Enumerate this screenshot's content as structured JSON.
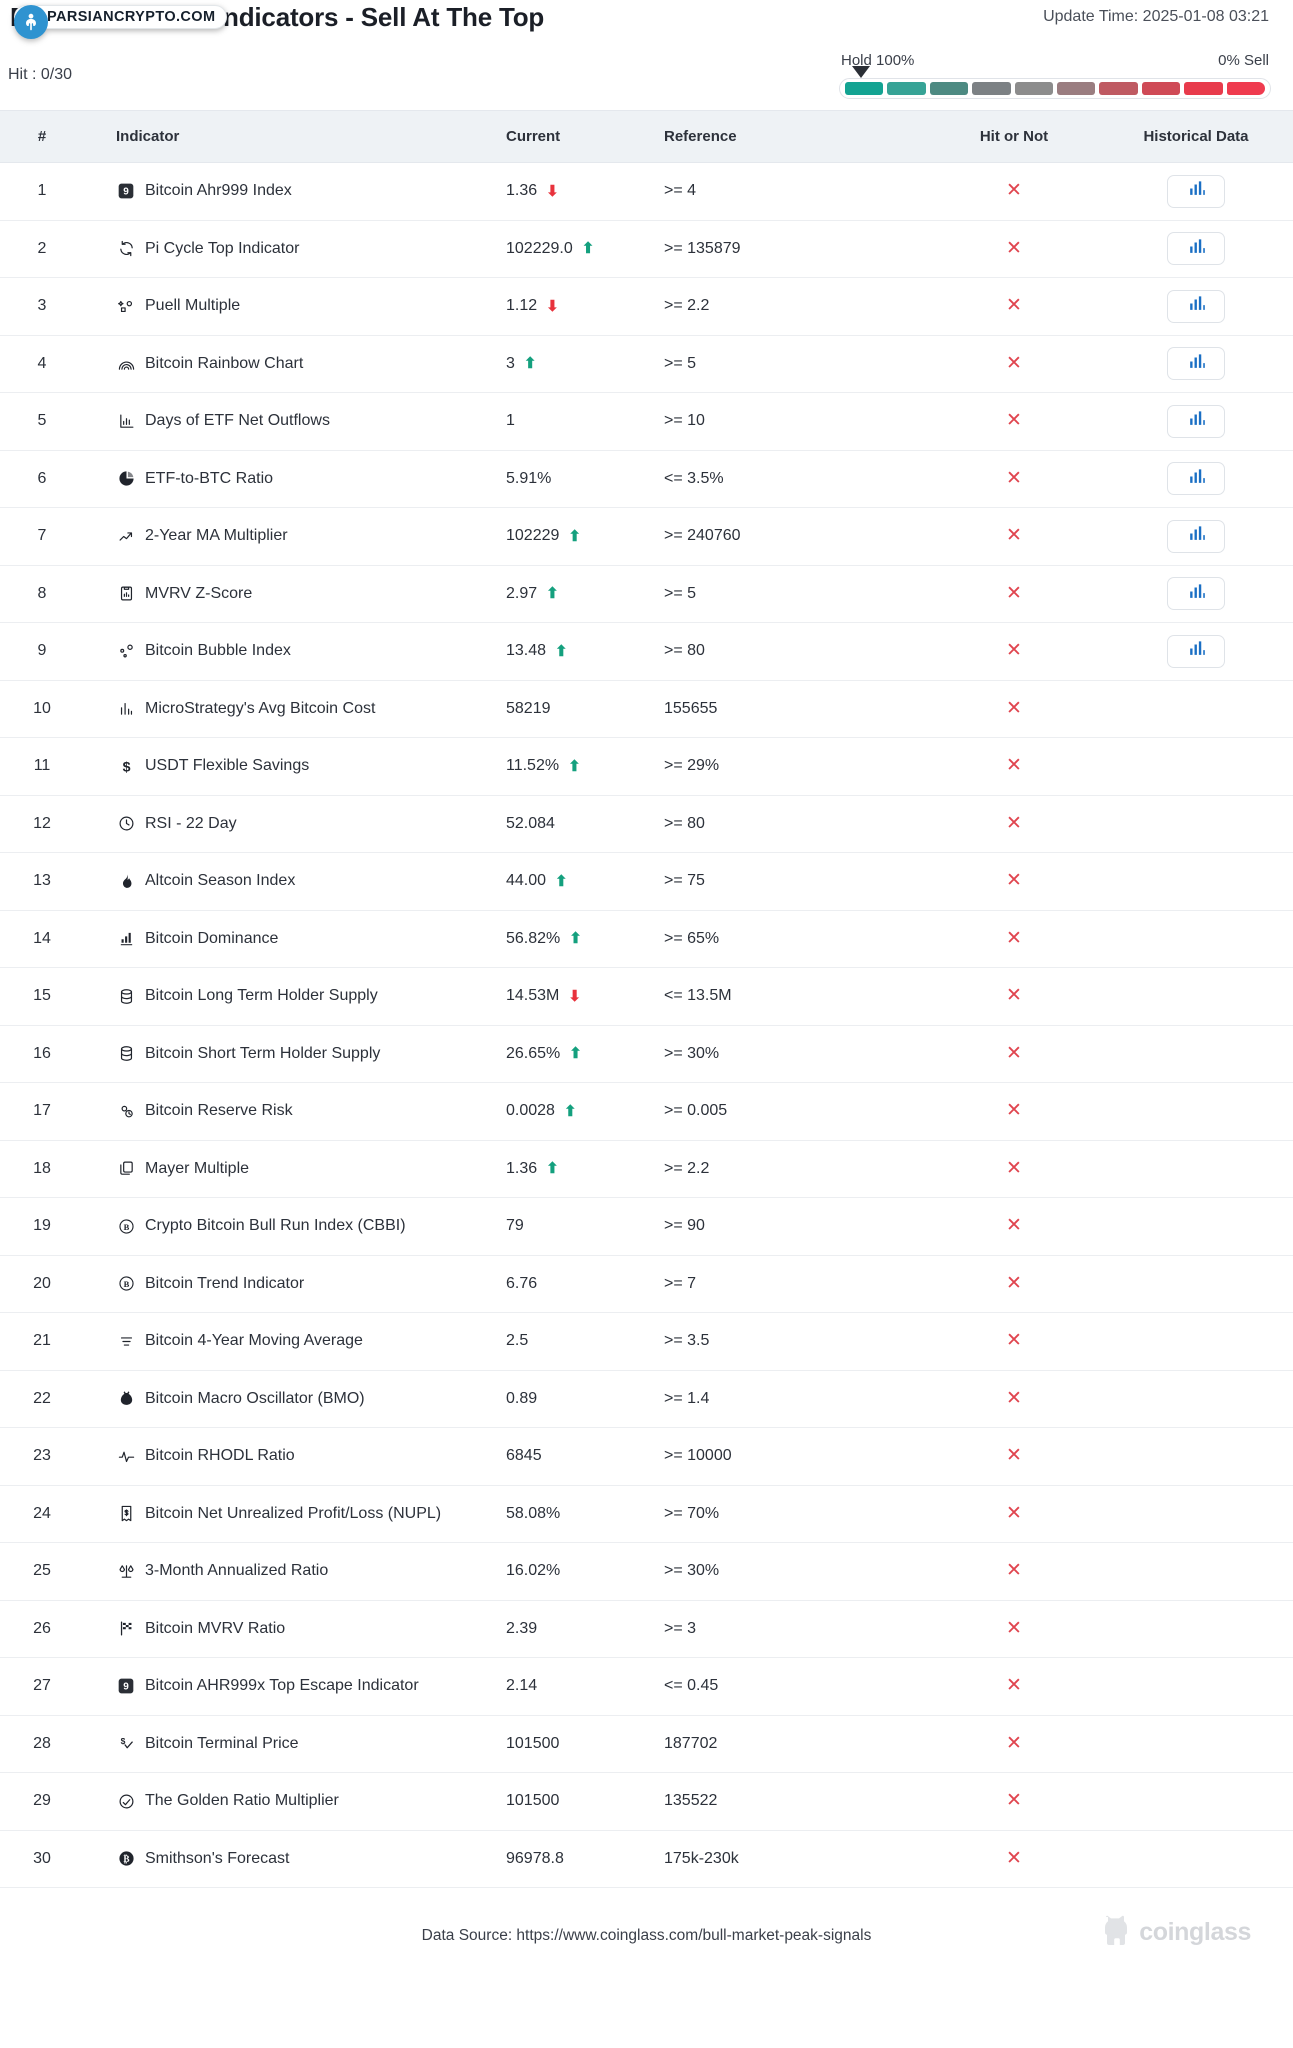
{
  "header": {
    "title": "Bitcoin Bull Run Indicators - Sell At The Top",
    "update_time": "Update Time: 2025-01-08 03:21",
    "watermark": "PARSIANCRYPTO.COM",
    "watermark_icon": "parsiancrypto-logo-icon"
  },
  "summary": {
    "hit_label": "Hit : 0/30",
    "gauge_left_label": "Hold 100%",
    "gauge_right_label": "0% Sell",
    "gauge_pointer_percent": 0,
    "gauge_segments": [
      "#13a392",
      "#36a396",
      "#4d8a82",
      "#7c8184",
      "#8c8c8c",
      "#9a7d80",
      "#bf5a62",
      "#cf4a56",
      "#e83b4c",
      "#ef3b4f"
    ]
  },
  "table": {
    "columns": [
      "#",
      "Indicator",
      "Current",
      "Reference",
      "Hit or Not",
      "Historical Data"
    ],
    "hit_icon": "x-mark-icon",
    "history_icon": "bar-chart-icon",
    "rows": [
      {
        "num": "1",
        "icon": "ahr999-badge-icon",
        "name": "Bitcoin Ahr999 Index",
        "current": "1.36",
        "trend": "down",
        "reference": ">= 4",
        "hit": false,
        "history": true
      },
      {
        "num": "2",
        "icon": "refresh-cycle-icon",
        "name": "Pi Cycle Top Indicator",
        "current": "102229.0",
        "trend": "up",
        "reference": ">= 135879",
        "hit": false,
        "history": true
      },
      {
        "num": "3",
        "icon": "sparkle-node-icon",
        "name": "Puell Multiple",
        "current": "1.12",
        "trend": "down",
        "reference": ">= 2.2",
        "hit": false,
        "history": true
      },
      {
        "num": "4",
        "icon": "rainbow-icon",
        "name": "Bitcoin Rainbow Chart",
        "current": "3",
        "trend": "up",
        "reference": ">= 5",
        "hit": false,
        "history": true
      },
      {
        "num": "5",
        "icon": "bar-chart-axis-icon",
        "name": "Days of ETF Net Outflows",
        "current": "1",
        "trend": "none",
        "reference": ">= 10",
        "hit": false,
        "history": true
      },
      {
        "num": "6",
        "icon": "pie-chart-icon",
        "name": "ETF-to-BTC Ratio",
        "current": "5.91%",
        "trend": "none",
        "reference": "<= 3.5%",
        "hit": false,
        "history": true
      },
      {
        "num": "7",
        "icon": "trend-line-icon",
        "name": "2-Year MA Multiplier",
        "current": "102229",
        "trend": "up",
        "reference": ">= 240760",
        "hit": false,
        "history": true
      },
      {
        "num": "8",
        "icon": "clipboard-chart-icon",
        "name": "MVRV Z-Score",
        "current": "2.97",
        "trend": "up",
        "reference": ">= 5",
        "hit": false,
        "history": true
      },
      {
        "num": "9",
        "icon": "bubble-nodes-icon",
        "name": "Bitcoin Bubble Index",
        "current": "13.48",
        "trend": "up",
        "reference": ">= 80",
        "hit": false,
        "history": true
      },
      {
        "num": "10",
        "icon": "bar-chart-small-icon",
        "name": "MicroStrategy's Avg Bitcoin Cost",
        "current": "58219",
        "trend": "none",
        "reference": "155655",
        "hit": false,
        "history": false
      },
      {
        "num": "11",
        "icon": "dollar-sign-icon",
        "name": "USDT Flexible Savings",
        "current": "11.52%",
        "trend": "up",
        "reference": ">= 29%",
        "hit": false,
        "history": false
      },
      {
        "num": "12",
        "icon": "clock-icon",
        "name": "RSI - 22 Day",
        "current": "52.084",
        "trend": "none",
        "reference": ">= 80",
        "hit": false,
        "history": false
      },
      {
        "num": "13",
        "icon": "flame-icon",
        "name": "Altcoin Season Index",
        "current": "44.00",
        "trend": "up",
        "reference": ">= 75",
        "hit": false,
        "history": false
      },
      {
        "num": "14",
        "icon": "growth-chart-icon",
        "name": "Bitcoin Dominance",
        "current": "56.82%",
        "trend": "up",
        "reference": ">= 65%",
        "hit": false,
        "history": false
      },
      {
        "num": "15",
        "icon": "database-icon",
        "name": "Bitcoin Long Term Holder Supply",
        "current": "14.53M",
        "trend": "down",
        "reference": "<= 13.5M",
        "hit": false,
        "history": false
      },
      {
        "num": "16",
        "icon": "database-icon",
        "name": "Bitcoin Short Term Holder Supply",
        "current": "26.65%",
        "trend": "up",
        "reference": ">= 30%",
        "hit": false,
        "history": false
      },
      {
        "num": "17",
        "icon": "reserve-risk-icon",
        "name": "Bitcoin Reserve Risk",
        "current": "0.0028",
        "trend": "up",
        "reference": ">= 0.005",
        "hit": false,
        "history": false
      },
      {
        "num": "18",
        "icon": "copy-layers-icon",
        "name": "Mayer Multiple",
        "current": "1.36",
        "trend": "up",
        "reference": ">= 2.2",
        "hit": false,
        "history": false
      },
      {
        "num": "19",
        "icon": "bitcoin-circle-icon",
        "name": "Crypto Bitcoin Bull Run Index (CBBI)",
        "current": "79",
        "trend": "none",
        "reference": ">= 90",
        "hit": false,
        "history": false
      },
      {
        "num": "20",
        "icon": "bitcoin-circle-icon",
        "name": "Bitcoin Trend Indicator",
        "current": "6.76",
        "trend": "none",
        "reference": ">= 7",
        "hit": false,
        "history": false
      },
      {
        "num": "21",
        "icon": "stacked-lines-icon",
        "name": "Bitcoin 4-Year Moving Average",
        "current": "2.5",
        "trend": "none",
        "reference": ">= 3.5",
        "hit": false,
        "history": false
      },
      {
        "num": "22",
        "icon": "money-bag-icon",
        "name": "Bitcoin Macro Oscillator (BMO)",
        "current": "0.89",
        "trend": "none",
        "reference": ">= 1.4",
        "hit": false,
        "history": false
      },
      {
        "num": "23",
        "icon": "pulse-icon",
        "name": "Bitcoin RHODL Ratio",
        "current": "6845",
        "trend": "none",
        "reference": ">= 10000",
        "hit": false,
        "history": false
      },
      {
        "num": "24",
        "icon": "receipt-icon",
        "name": "Bitcoin Net Unrealized Profit/Loss (NUPL)",
        "current": "58.08%",
        "trend": "none",
        "reference": ">= 70%",
        "hit": false,
        "history": false
      },
      {
        "num": "25",
        "icon": "scales-icon",
        "name": "3-Month Annualized Ratio",
        "current": "16.02%",
        "trend": "none",
        "reference": ">= 30%",
        "hit": false,
        "history": false
      },
      {
        "num": "26",
        "icon": "checkered-flag-icon",
        "name": "Bitcoin MVRV Ratio",
        "current": "2.39",
        "trend": "none",
        "reference": ">= 3",
        "hit": false,
        "history": false
      },
      {
        "num": "27",
        "icon": "ahr999-badge-icon",
        "name": "Bitcoin AHR999x Top Escape Indicator",
        "current": "2.14",
        "trend": "none",
        "reference": "<= 0.45",
        "hit": false,
        "history": false
      },
      {
        "num": "28",
        "icon": "price-check-icon",
        "name": "Bitcoin Terminal Price",
        "current": "101500",
        "trend": "none",
        "reference": "187702",
        "hit": false,
        "history": false
      },
      {
        "num": "29",
        "icon": "golden-ratio-icon",
        "name": "The Golden Ratio Multiplier",
        "current": "101500",
        "trend": "none",
        "reference": "135522",
        "hit": false,
        "history": false
      },
      {
        "num": "30",
        "icon": "bitcoin-solid-icon",
        "name": "Smithson's Forecast",
        "current": "96978.8",
        "trend": "none",
        "reference": "175k-230k",
        "hit": false,
        "history": false
      }
    ]
  },
  "footer": {
    "data_source": "Data Source: https://www.coinglass.com/bull-market-peak-signals",
    "brand_name": "coinglass",
    "brand_icon": "coinglass-mascot-icon"
  }
}
